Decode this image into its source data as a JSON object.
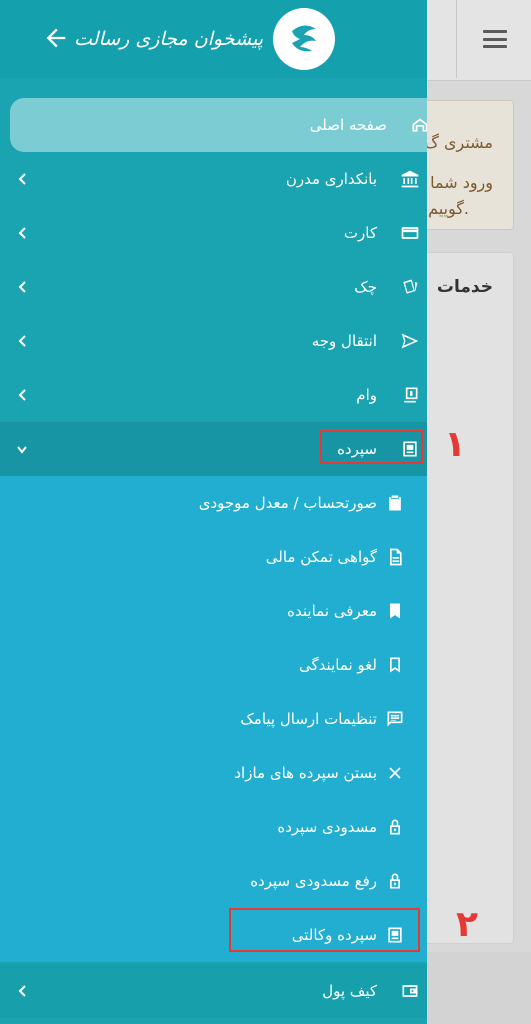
{
  "background": {
    "card1_line1": "مشتری گ",
    "card1_line2": "ورود شما",
    "card1_line3": "گوییم.",
    "card2_title": "خدمات"
  },
  "header": {
    "logo_text": "پیشخوان مجازی رسالت",
    "back_icon": "arrow-left-icon",
    "logo_icon": "resalat-logo-icon"
  },
  "menu": {
    "items": [
      {
        "label": "صفحه اصلی",
        "icon": "home-icon"
      },
      {
        "label": "بانکداری مدرن",
        "icon": "bank-icon"
      },
      {
        "label": "کارت",
        "icon": "card-icon"
      },
      {
        "label": "چک",
        "icon": "cheque-icon"
      },
      {
        "label": "انتقال وجه",
        "icon": "send-icon"
      },
      {
        "label": "وام",
        "icon": "loan-icon"
      },
      {
        "label": "سپرده",
        "icon": "deposit-icon"
      }
    ],
    "deposit_sub": [
      {
        "label": "صورتحساب / معدل موجودی",
        "icon": "clipboard-icon"
      },
      {
        "label": "گواهی تمکن مالی",
        "icon": "document-icon"
      },
      {
        "label": "معرفی نماینده",
        "icon": "bookmark-filled-icon"
      },
      {
        "label": "لغو نمایندگی",
        "icon": "bookmark-outline-icon"
      },
      {
        "label": "تنظیمات ارسال پیامک",
        "icon": "message-icon"
      },
      {
        "label": "بستن سپرده های مازاد",
        "icon": "close-icon"
      },
      {
        "label": "مسدودی سپرده",
        "icon": "lock-icon"
      },
      {
        "label": "رفع مسدودی سپرده",
        "icon": "unlock-icon"
      },
      {
        "label": "سپرده وکالتی",
        "icon": "proxy-deposit-icon"
      }
    ],
    "wallet": {
      "label": "کیف پول",
      "icon": "wallet-icon"
    }
  },
  "annotations": {
    "num1": "۱",
    "num2": "۲",
    "color": "#e53935"
  },
  "colors": {
    "drawer": "#1aa3b0",
    "submenu": "#22aed0",
    "home_highlight": "#7ccdd3"
  }
}
